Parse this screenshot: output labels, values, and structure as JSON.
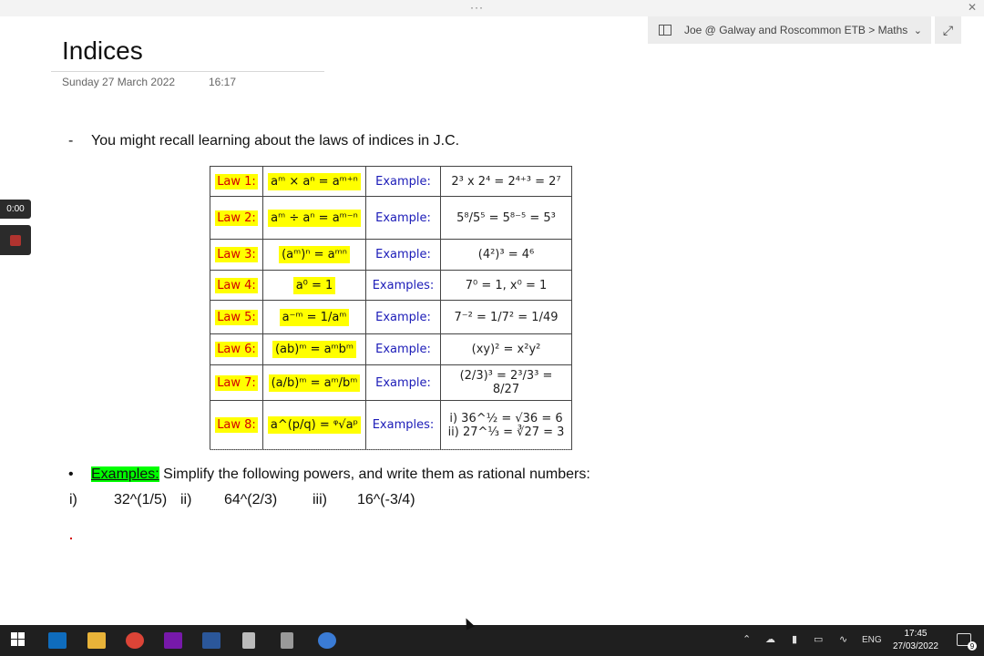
{
  "app": {
    "window_dots": "···",
    "close": "✕"
  },
  "notebook": {
    "path": "Joe @ Galway and Roscommon ETB > Maths"
  },
  "page": {
    "title": "Indices",
    "date": "Sunday 27 March 2022",
    "time": "16:17"
  },
  "recording": {
    "timer": "0:00"
  },
  "intro": {
    "bullet": "-",
    "text": "You might recall learning about the laws of indices in J.C."
  },
  "laws": [
    {
      "name": "Law 1:",
      "formula": "aᵐ × aⁿ = aᵐ⁺ⁿ",
      "label": "Example:",
      "example": "2³ x 2⁴ = 2⁴⁺³ = 2⁷"
    },
    {
      "name": "Law 2:",
      "formula": "aᵐ ÷ aⁿ = aᵐ⁻ⁿ",
      "label": "Example:",
      "example": "5⁸/5⁵ = 5⁸⁻⁵ = 5³"
    },
    {
      "name": "Law 3:",
      "formula": "(aᵐ)ⁿ = aᵐⁿ",
      "label": "Example:",
      "example": "(4²)³ = 4⁶"
    },
    {
      "name": "Law 4:",
      "formula": "a⁰ = 1",
      "label": "Examples:",
      "example": "7⁰ = 1, x⁰ = 1"
    },
    {
      "name": "Law 5:",
      "formula": "a⁻ᵐ = 1/aᵐ",
      "label": "Example:",
      "example": "7⁻² = 1/7² = 1/49"
    },
    {
      "name": "Law 6:",
      "formula": "(ab)ᵐ = aᵐbᵐ",
      "label": "Example:",
      "example": "(xy)² = x²y²"
    },
    {
      "name": "Law 7:",
      "formula": "(a/b)ᵐ = aᵐ/bᵐ",
      "label": "Example:",
      "example": "(2/3)³ = 2³/3³ = 8/27"
    },
    {
      "name": "Law 8:",
      "formula": "a^(p/q) = ᵠ√aᵖ",
      "label": "Examples:",
      "example": "i) 36^½ = √36 = 6",
      "example2": "ii) 27^⅓ = ∛27 = 3"
    }
  ],
  "examples": {
    "bullet": "•",
    "label": "Examples:",
    "text": " Simplify the following powers, and write them as rational numbers:"
  },
  "questions": [
    {
      "num": "i)",
      "expr": "32^(1/5)"
    },
    {
      "num": "ii)",
      "expr": "64^(2/3)"
    },
    {
      "num": "iii)",
      "expr": "16^(-3/4)"
    }
  ],
  "taskbar": {
    "apps": [
      "windows-start",
      "outlook",
      "file-explorer",
      "chrome",
      "onenote",
      "word",
      "calculator",
      "calculator-alt",
      "globe-app"
    ],
    "tray": {
      "lang": "ENG",
      "time": "17:45",
      "date": "27/03/2022",
      "notifications": "9"
    }
  }
}
